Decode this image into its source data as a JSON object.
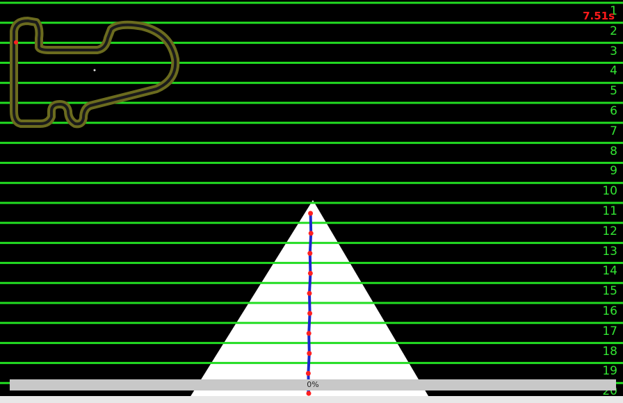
{
  "hud": {
    "lap_time": "7.51s",
    "progress_percent": 0,
    "progress_label": "0%"
  },
  "rows": {
    "labels": [
      "1",
      "2",
      "3",
      "4",
      "5",
      "6",
      "7",
      "8",
      "9",
      "10",
      "11",
      "12",
      "13",
      "14",
      "15",
      "16",
      "17",
      "18",
      "19",
      "20"
    ]
  },
  "colors": {
    "background": "#000000",
    "row_line": "#22dd22",
    "row_label": "#33e633",
    "vision_cone": "#ffffff",
    "path": "#1a2acc",
    "path_marker": "#ff2020",
    "track_outer": "#6b6b1e",
    "track_inner": "#1a1a1a",
    "timer": "#ff1a1a",
    "progress_bar": "#c8c8c8"
  }
}
